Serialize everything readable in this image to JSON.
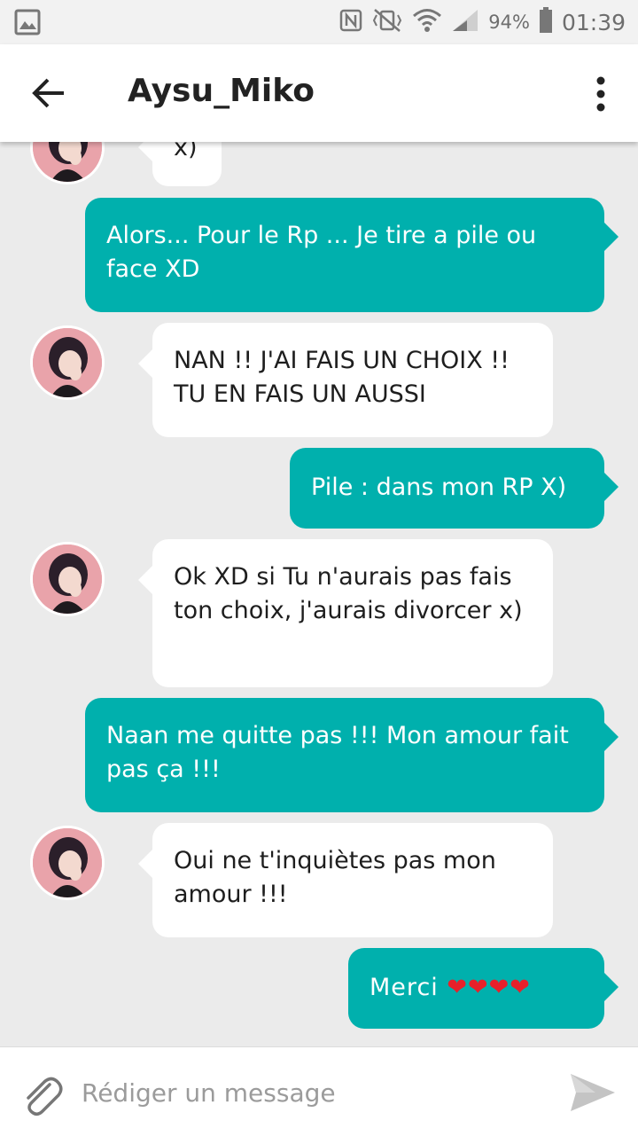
{
  "status_bar": {
    "battery_percent": "94%",
    "time": "01:39"
  },
  "header": {
    "title": "Aysu_Miko"
  },
  "messages": [
    {
      "side": "received",
      "text": "x)"
    },
    {
      "side": "sent",
      "text": "Alors... Pour le Rp ... Je tire a pile ou face XD"
    },
    {
      "side": "received",
      "text": "NAN !! J'AI FAIS UN CHOIX !! TU EN FAIS UN AUSSI"
    },
    {
      "side": "sent",
      "text": "Pile : dans mon RP X)"
    },
    {
      "side": "received",
      "text": "Ok XD si Tu n'aurais pas fais ton choix, j'aurais divorcer x)"
    },
    {
      "side": "sent",
      "text": "Naan me quitte pas !!! Mon amour fait pas ça !!!"
    },
    {
      "side": "received",
      "text": "Oui ne t'inquiètes pas mon amour !!!"
    },
    {
      "side": "sent",
      "text": "Merci ❤❤❤❤"
    }
  ],
  "composer": {
    "placeholder": "Rédiger un message"
  },
  "colors": {
    "sent_bubble": "#00b0ad",
    "received_bubble": "#ffffff",
    "background": "#ebebeb"
  }
}
